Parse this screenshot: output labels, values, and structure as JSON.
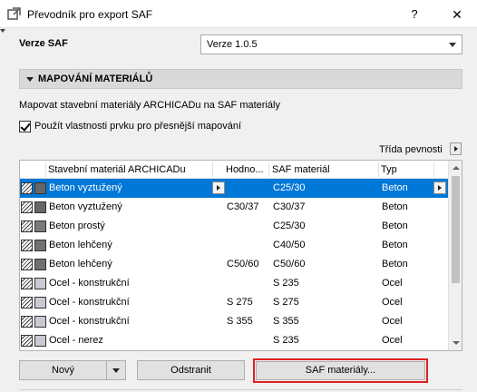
{
  "window": {
    "title": "Převodník pro export SAF",
    "help_label": "?",
    "close_label": "✕"
  },
  "saf_version": {
    "label": "Verze SAF",
    "selected": "Verze 1.0.5"
  },
  "section": {
    "title": "MAPOVÁNÍ MATERIÁLŮ",
    "description": "Mapovat stavební materiály ARCHICADu na SAF materiály",
    "checkbox_label": "Použít vlastnosti prvku pro přesnější mapování",
    "checkbox_checked": true,
    "strength_class_label": "Třída pevnosti"
  },
  "table": {
    "columns": [
      "Stavební materiál ARCHICADu",
      "Hodno...",
      "SAF materiál",
      "Typ"
    ],
    "rows": [
      {
        "material": "Beton vyztužený",
        "value": "",
        "saf": "C25/30",
        "type": "Beton",
        "fill": "#666666",
        "selected": true
      },
      {
        "material": "Beton vyztužený",
        "value": "C30/37",
        "saf": "C30/37",
        "type": "Beton",
        "fill": "#666666",
        "selected": false
      },
      {
        "material": "Beton prostý",
        "value": "",
        "saf": "C25/30",
        "type": "Beton",
        "fill": "#7a7a7a",
        "selected": false
      },
      {
        "material": "Beton lehčený",
        "value": "",
        "saf": "C40/50",
        "type": "Beton",
        "fill": "#707070",
        "selected": false
      },
      {
        "material": "Beton lehčený",
        "value": "C50/60",
        "saf": "C50/60",
        "type": "Beton",
        "fill": "#707070",
        "selected": false
      },
      {
        "material": "Ocel - konstrukční",
        "value": "",
        "saf": "S 235",
        "type": "Ocel",
        "fill": "#c9c9d2",
        "selected": false
      },
      {
        "material": "Ocel - konstrukční",
        "value": "S 275",
        "saf": "S 275",
        "type": "Ocel",
        "fill": "#c9c9d2",
        "selected": false
      },
      {
        "material": "Ocel - konstrukční",
        "value": "S 355",
        "saf": "S 355",
        "type": "Ocel",
        "fill": "#c9c9d2",
        "selected": false
      },
      {
        "material": "Ocel - nerez",
        "value": "",
        "saf": "S 235",
        "type": "Ocel",
        "fill": "#c9c9d2",
        "selected": false
      }
    ]
  },
  "buttons": {
    "new_label": "Nový",
    "delete_label": "Odstranit",
    "saf_materials_label": "SAF materiály..."
  },
  "colors": {
    "selection": "#0078d7",
    "highlight_border": "#e02020"
  }
}
